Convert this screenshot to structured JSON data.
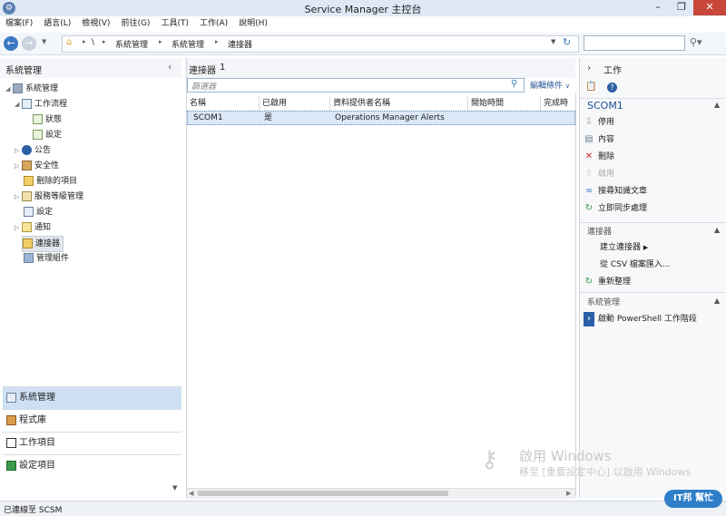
{
  "window": {
    "title": "Service Manager 主控台"
  },
  "menu": [
    "檔案(F)",
    "語言(L)",
    "檢視(V)",
    "前往(G)",
    "工具(T)",
    "工作(A)",
    "說明(H)"
  ],
  "breadcrumb": [
    "\\",
    "系統管理",
    "系統管理",
    "連接器"
  ],
  "left": {
    "header": "系統管理",
    "tree": [
      {
        "label": "系統管理",
        "level": 0,
        "expanded": true
      },
      {
        "label": "工作流程",
        "level": 1,
        "expanded": true
      },
      {
        "label": "狀態",
        "level": 2
      },
      {
        "label": "設定",
        "level": 2
      },
      {
        "label": "公告",
        "level": 1
      },
      {
        "label": "安全性",
        "level": 1
      },
      {
        "label": "刪除的項目",
        "level": 1
      },
      {
        "label": "服務等級管理",
        "level": 1
      },
      {
        "label": "設定",
        "level": 1
      },
      {
        "label": "通知",
        "level": 1
      },
      {
        "label": "連接器",
        "level": 1,
        "selected": true
      },
      {
        "label": "管理組件",
        "level": 1
      }
    ],
    "wunderbar": [
      "系統管理",
      "程式庫",
      "工作項目",
      "設定項目"
    ]
  },
  "center": {
    "title": "連接器",
    "count": "1",
    "filter_placeholder": "篩選器",
    "edit_criteria": "編輯條件",
    "columns": [
      "名稱",
      "已啟用",
      "資料提供者名稱",
      "開始時間",
      "完成時間"
    ],
    "rows": [
      {
        "name": "SCOM1",
        "enabled": "是",
        "provider": "Operations Manager Alerts",
        "start": "",
        "finish": ""
      }
    ]
  },
  "tasks": {
    "header": "工作",
    "selected_title": "SCOM1",
    "item_tasks": [
      {
        "label": "停用",
        "icon": "disable-icon",
        "enabled": true
      },
      {
        "label": "內容",
        "icon": "properties-icon",
        "enabled": true
      },
      {
        "label": "刪除",
        "icon": "delete-icon",
        "enabled": true
      },
      {
        "label": "啟用",
        "icon": "enable-icon",
        "enabled": false
      },
      {
        "label": "搜尋知識文章",
        "icon": "search-knowledge-icon",
        "enabled": true
      },
      {
        "label": "立即同步處理",
        "icon": "sync-icon",
        "enabled": true
      }
    ],
    "connectors_title": "連接器",
    "connector_tasks": [
      "建立連接器",
      "從 CSV 檔案匯入...",
      "重新整理"
    ],
    "admin_title": "系統管理",
    "admin_tasks": [
      "啟動 PowerShell 工作階段"
    ]
  },
  "status": {
    "text": "已連線至 SCSM"
  },
  "watermark": {
    "line1": "啟用 Windows",
    "line2": "移至 [重要設定中心] 以啟用 Windows"
  },
  "logo_text": "IT邦 幫忙",
  "colors": {
    "accent": "#3b78c2",
    "selection": "#dbe8f7",
    "delete": "#d03030"
  }
}
